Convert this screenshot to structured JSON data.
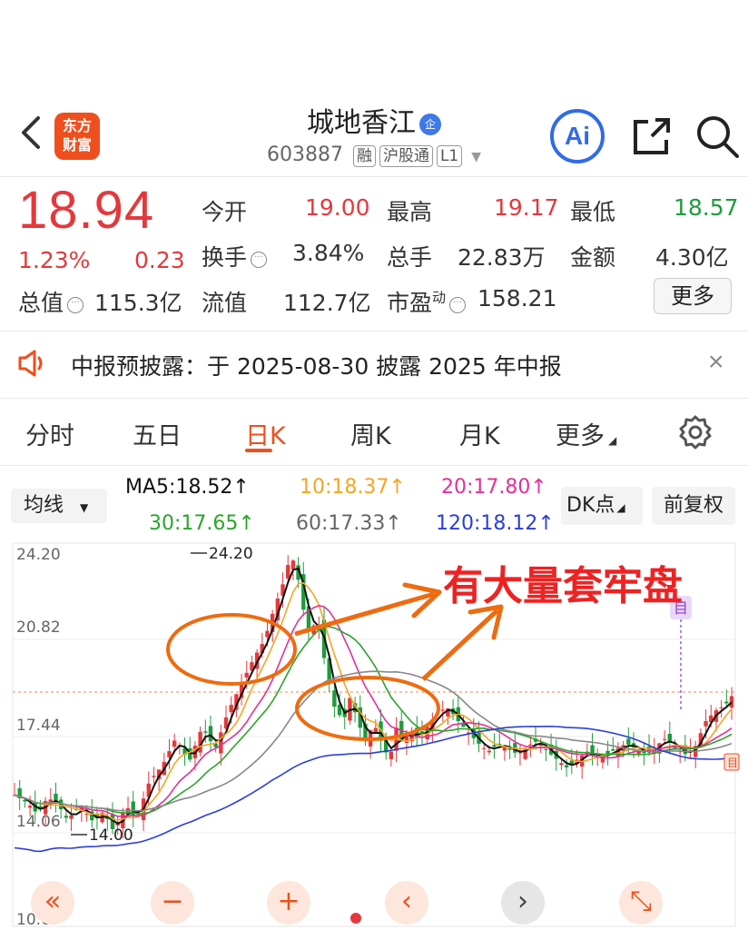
{
  "header": {
    "logo_line1": "东方",
    "logo_line2": "财富",
    "stock_name": "城地香江",
    "verified_badge": "企",
    "stock_code": "603887",
    "tags": [
      "融",
      "沪股通",
      "L1"
    ],
    "ai_label": "Ai"
  },
  "quote": {
    "price": "18.94",
    "change_pct": "1.23%",
    "change_amt": "0.23",
    "fields": [
      {
        "label": "今开",
        "value": "19.00",
        "color": "red"
      },
      {
        "label": "最高",
        "value": "19.17",
        "color": "red"
      },
      {
        "label": "最低",
        "value": "18.57",
        "color": "green"
      },
      {
        "label": "换手",
        "value": "3.84%"
      },
      {
        "label": "总手",
        "value": "22.83万"
      },
      {
        "label": "金额",
        "value": "4.30亿"
      },
      {
        "label": "总值",
        "value": "115.3亿"
      },
      {
        "label": "流值",
        "value": "112.7亿"
      },
      {
        "label": "市盈",
        "sup": "动",
        "value": "158.21"
      }
    ],
    "more_label": "更多"
  },
  "notice": {
    "text": "中报预披露：于 2025-08-30 披露 2025 年中报",
    "close": "×"
  },
  "tabs": {
    "items": [
      "分时",
      "五日",
      "日K",
      "周K",
      "月K",
      "更多"
    ],
    "active": "日K"
  },
  "ma": {
    "selector": "均线",
    "ma5": "MA5:18.52↑",
    "ma10": "10:18.37↑",
    "ma20": "20:17.80↑",
    "ma30": "30:17.65↑",
    "ma60": "60:17.33↑",
    "ma120": "120:18.12↑",
    "dk_label": "DK点",
    "adjust_label": "前复权",
    "colors": {
      "ma5": "#111111",
      "ma10": "#f5a623",
      "ma20": "#e0309a",
      "ma30": "#2aa52a",
      "ma60": "#888888",
      "ma120": "#2b3fd6"
    }
  },
  "chart_data": {
    "type": "candlestick",
    "y_ticks": [
      "24.20",
      "20.82",
      "17.44",
      "14.06",
      "10.67"
    ],
    "ylim": [
      10.67,
      24.2
    ],
    "high_label": "24.20",
    "low_label": "14.00",
    "annotation": "有大量套牢盘",
    "marker_label": "目",
    "last_price": 18.94,
    "bullish_color": "#e4393c",
    "bearish_color": "#1c9c3c",
    "annotation_color": "#ee2222",
    "circle_color": "#ee6b10"
  },
  "controls": {
    "rewind": "«",
    "zoom_out": "−",
    "zoom_in": "+",
    "prev": "‹",
    "next": "›",
    "expand": "⤡"
  }
}
